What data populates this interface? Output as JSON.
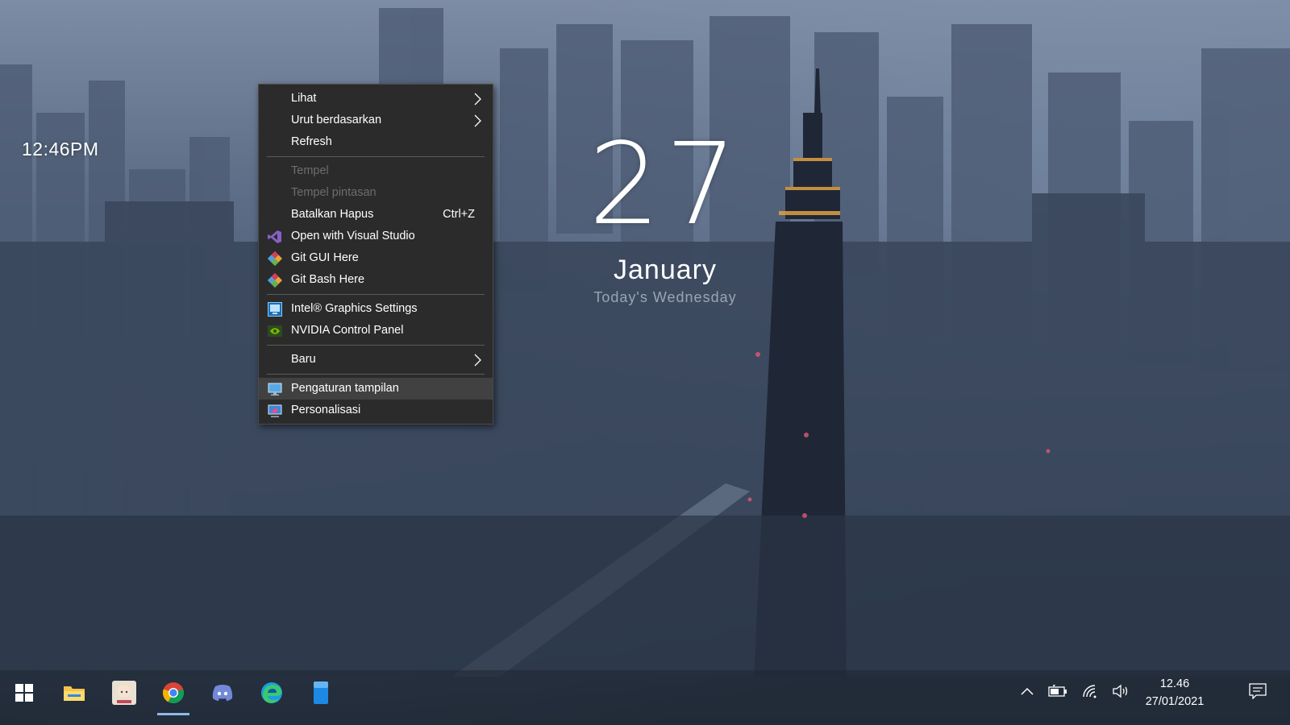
{
  "desktop": {
    "clock_widget": "12:46PM",
    "date_widget": {
      "day": "27",
      "month": "January",
      "weekday": "Today's Wednesday"
    }
  },
  "context_menu": {
    "items": [
      {
        "label": "Lihat",
        "submenu": true
      },
      {
        "label": "Urut berdasarkan",
        "submenu": true
      },
      {
        "label": "Refresh"
      },
      {
        "label": "Tempel",
        "disabled": true
      },
      {
        "label": "Tempel pintasan",
        "disabled": true
      },
      {
        "label": "Batalkan Hapus",
        "shortcut": "Ctrl+Z"
      },
      {
        "label": "Open with Visual Studio",
        "icon": "visual-studio-icon"
      },
      {
        "label": "Git GUI Here",
        "icon": "git-icon"
      },
      {
        "label": "Git Bash Here",
        "icon": "git-icon"
      },
      {
        "label": "Intel® Graphics Settings",
        "icon": "intel-graphics-icon"
      },
      {
        "label": "NVIDIA Control Panel",
        "icon": "nvidia-icon"
      },
      {
        "label": "Baru",
        "submenu": true
      },
      {
        "label": "Pengaturan tampilan",
        "icon": "display-settings-icon",
        "highlighted": true
      },
      {
        "label": "Personalisasi",
        "icon": "personalize-icon"
      }
    ]
  },
  "taskbar": {
    "apps": [
      "windows-start-icon",
      "file-explorer-icon",
      "anime-app-icon",
      "chrome-icon",
      "discord-icon",
      "edge-icon",
      "blue-app-icon"
    ],
    "active_app": "chrome-icon",
    "tray": [
      "show-hidden-icons-chevron",
      "battery-icon",
      "wifi-icon",
      "volume-icon"
    ],
    "time": "12.46",
    "date": "27/01/2021"
  },
  "colors": {
    "menu_bg": "#2b2b2b",
    "menu_highlight": "#414141",
    "menu_disabled_text": "#6d6d6d",
    "taskbar_active_indicator": "#8fb8e8"
  }
}
